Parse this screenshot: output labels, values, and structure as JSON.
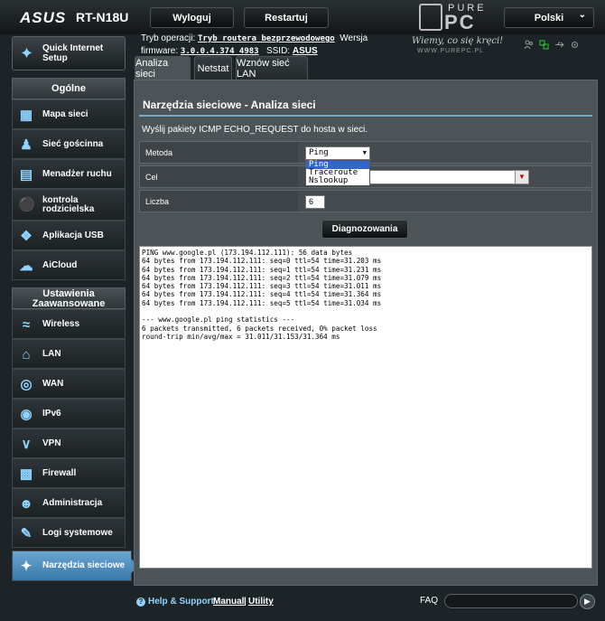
{
  "header": {
    "brand": "ASUS",
    "model": "RT-N18U",
    "logout_label": "Wyloguj",
    "restart_label": "Restartuj",
    "language": "Polski"
  },
  "watermark": {
    "pure": "PURE",
    "pc": "PC",
    "slogan": "Wiemy, co się kręci!",
    "url": "WWW.PUREPC.PL"
  },
  "info": {
    "mode_label": "Tryb operacji:",
    "mode_value": "Tryb routera bezprzewodowego",
    "version_label": "Wersja",
    "firmware_label": "firmware:",
    "firmware_value": "3.0.0.4.374_4983",
    "ssid_label": "SSID:",
    "ssid_value": "ASUS"
  },
  "sidebar": {
    "quick_setup": "Quick Internet Setup",
    "general_header": "Ogólne",
    "general_items": [
      {
        "label": "Mapa sieci",
        "icon": "network-map-icon"
      },
      {
        "label": "Sieć gościnna",
        "icon": "guest-network-icon"
      },
      {
        "label": "Menadżer ruchu",
        "icon": "traffic-manager-icon"
      },
      {
        "label": "kontrola rodzicielska",
        "icon": "parental-control-icon"
      },
      {
        "label": "Aplikacja USB",
        "icon": "usb-app-icon"
      },
      {
        "label": "AiCloud",
        "icon": "aicloud-icon"
      }
    ],
    "advanced_header": "Ustawienia Zaawansowane",
    "advanced_items": [
      {
        "label": "Wireless",
        "icon": "wireless-icon"
      },
      {
        "label": "LAN",
        "icon": "lan-icon"
      },
      {
        "label": "WAN",
        "icon": "wan-icon"
      },
      {
        "label": "IPv6",
        "icon": "ipv6-icon"
      },
      {
        "label": "VPN",
        "icon": "vpn-icon"
      },
      {
        "label": "Firewall",
        "icon": "firewall-icon"
      },
      {
        "label": "Administracja",
        "icon": "administration-icon"
      },
      {
        "label": "Logi systemowe",
        "icon": "system-log-icon"
      },
      {
        "label": "Narzędzia sieciowe",
        "icon": "network-tools-icon"
      }
    ]
  },
  "tabs": [
    {
      "label": "Analiza sieci"
    },
    {
      "label": "Netstat"
    },
    {
      "label": "Wznów sieć LAN"
    }
  ],
  "main": {
    "title": "Narzędzia sieciowe - Analiza sieci",
    "description": "Wyślij pakiety ICMP ECHO_REQUEST do hosta w sieci.",
    "method_label": "Metoda",
    "method_value": "Ping",
    "method_options": [
      "Ping",
      "Traceroute",
      "Nslookup"
    ],
    "target_label": "Cel",
    "target_value": "",
    "count_label": "Liczba",
    "count_value": "6",
    "diagnose_label": "Diagnozowania",
    "output_lines": [
      "PING www.google.pl (173.194.112.111): 56 data bytes",
      "64 bytes from 173.194.112.111: seq=0 ttl=54 time=31.203 ms",
      "64 bytes from 173.194.112.111: seq=1 ttl=54 time=31.231 ms",
      "64 bytes from 173.194.112.111: seq=2 ttl=54 time=31.079 ms",
      "64 bytes from 173.194.112.111: seq=3 ttl=54 time=31.011 ms",
      "64 bytes from 173.194.112.111: seq=4 ttl=54 time=31.364 ms",
      "64 bytes from 173.194.112.111: seq=5 ttl=54 time=31.034 ms",
      "",
      "--- www.google.pl ping statistics ---",
      "6 packets transmitted, 6 packets received, 0% packet loss",
      "round-trip min/avg/max = 31.011/31.153/31.364 ms"
    ]
  },
  "footer": {
    "help": "Help & Support",
    "manual": "Manual",
    "separator": "|",
    "utility": "Utility",
    "faq": "FAQ"
  }
}
